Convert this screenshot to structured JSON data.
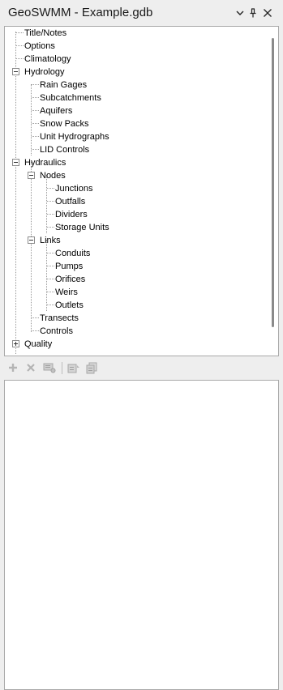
{
  "window": {
    "title": "GeoSWMM - Example.gdb"
  },
  "title_buttons": {
    "dropdown_icon": "chevron-down-icon",
    "pin_icon": "pin-icon",
    "close_icon": "close-icon"
  },
  "tree": {
    "items": [
      {
        "label": "Title/Notes"
      },
      {
        "label": "Options"
      },
      {
        "label": "Climatology"
      },
      {
        "label": "Hydrology",
        "expanded": true
      },
      {
        "label": "Rain Gages"
      },
      {
        "label": "Subcatchments"
      },
      {
        "label": "Aquifers"
      },
      {
        "label": "Snow Packs"
      },
      {
        "label": "Unit Hydrographs"
      },
      {
        "label": "LID Controls"
      },
      {
        "label": "Hydraulics",
        "expanded": true
      },
      {
        "label": "Nodes",
        "expanded": true
      },
      {
        "label": "Junctions"
      },
      {
        "label": "Outfalls"
      },
      {
        "label": "Dividers"
      },
      {
        "label": "Storage Units"
      },
      {
        "label": "Links",
        "expanded": true
      },
      {
        "label": "Conduits"
      },
      {
        "label": "Pumps"
      },
      {
        "label": "Orifices"
      },
      {
        "label": "Weirs"
      },
      {
        "label": "Outlets"
      },
      {
        "label": "Transects"
      },
      {
        "label": "Controls"
      },
      {
        "label": "Quality",
        "expanded": false
      }
    ]
  },
  "toolbar": {
    "tools": [
      {
        "icon": "add-icon",
        "enabled": false
      },
      {
        "icon": "delete-icon",
        "enabled": false
      },
      {
        "icon": "edit-icon",
        "enabled": false
      },
      {
        "icon": "properties-icon",
        "enabled": false
      },
      {
        "icon": "copy-icon",
        "enabled": false
      }
    ]
  }
}
